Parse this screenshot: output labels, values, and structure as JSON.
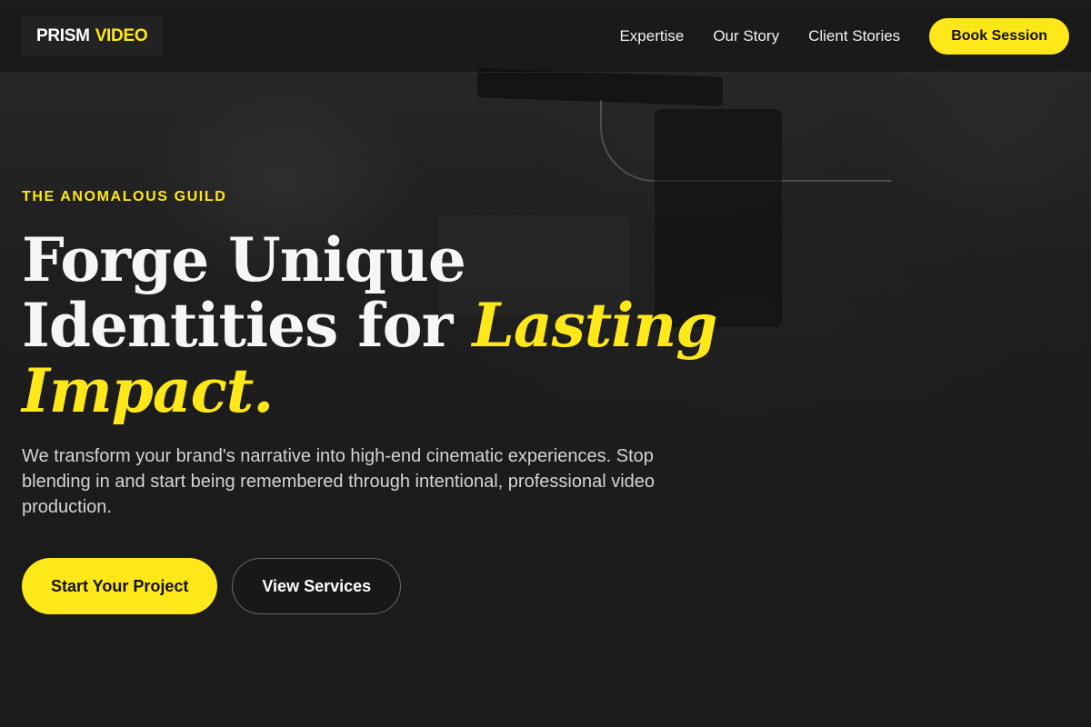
{
  "header": {
    "logo": {
      "word1": "PRISM",
      "word2": "VIDEO"
    },
    "nav": [
      {
        "label": "Expertise"
      },
      {
        "label": "Our Story"
      },
      {
        "label": "Client Stories"
      }
    ],
    "cta_label": "Book Session"
  },
  "hero": {
    "eyebrow": "THE ANOMALOUS GUILD",
    "headline": {
      "line1": "Forge Unique",
      "line2_plain": "Identities for ",
      "highlight": "Lasting Impact."
    },
    "lede": "We transform your brand's narrative into high-end cinematic experiences. Stop blending in and start being remembered through intentional, professional video production.",
    "primary_cta": "Start Your Project",
    "secondary_cta": "View Services"
  },
  "colors": {
    "accent": "#ffe81a",
    "background": "#1b1b1b",
    "text": "#f6f6f6"
  }
}
